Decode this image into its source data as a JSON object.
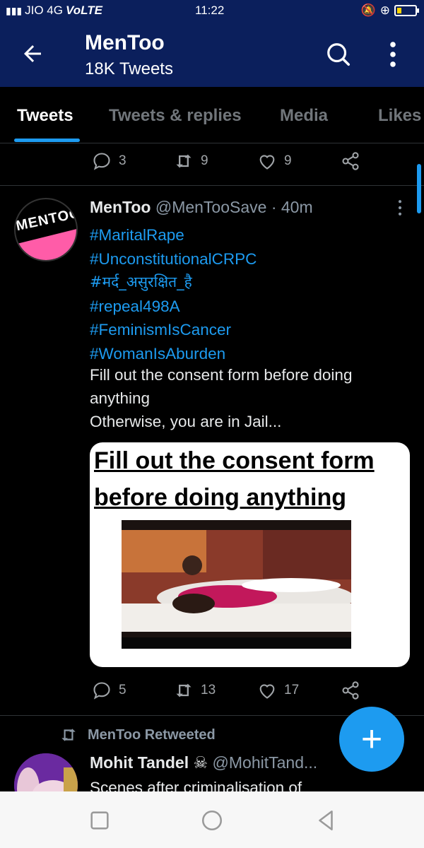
{
  "status_bar": {
    "carrier": "JIO 4G",
    "network_tag": "VoLTE",
    "time": "11:22"
  },
  "app_bar": {
    "title": "MenToo",
    "subtitle": "18K Tweets",
    "icons": [
      "back-arrow-icon",
      "search-icon",
      "more-vertical-icon"
    ]
  },
  "tabs": [
    {
      "label": "Tweets",
      "active": true
    },
    {
      "label": "Tweets & replies",
      "active": false
    },
    {
      "label": "Media",
      "active": false
    },
    {
      "label": "Likes",
      "active": false
    }
  ],
  "prev_tweet_actions": {
    "replies": "3",
    "retweets": "9",
    "likes": "9"
  },
  "tweet": {
    "avatar_text": "MENTOO",
    "name": "MenToo",
    "handle": "@MenTooSave",
    "time": "· 40m",
    "hashtags": [
      "#MaritalRape",
      "#UnconstitutionalCRPC",
      "#मर्द_असुरक्षित_है",
      "#repeal498A",
      "#FeminismIsCancer",
      "#WomanIsAburden"
    ],
    "text_lines": [
      "Fill out the consent form before doing",
      "anything",
      "Otherwise, you are in Jail..."
    ],
    "media_caption_lines": [
      "Fill out the consent form",
      "before doing anything"
    ],
    "actions": {
      "replies": "5",
      "retweets": "13",
      "likes": "17"
    }
  },
  "retweet": {
    "label": "MenToo Retweeted",
    "name": "Mohit Tandel",
    "handle": "@MohitTand...",
    "text": "Scenes after criminalisation of"
  },
  "fab": {
    "label": "+"
  },
  "colors": {
    "header": "#0b1f5c",
    "accent": "#1d9bf0",
    "background": "#000000"
  }
}
